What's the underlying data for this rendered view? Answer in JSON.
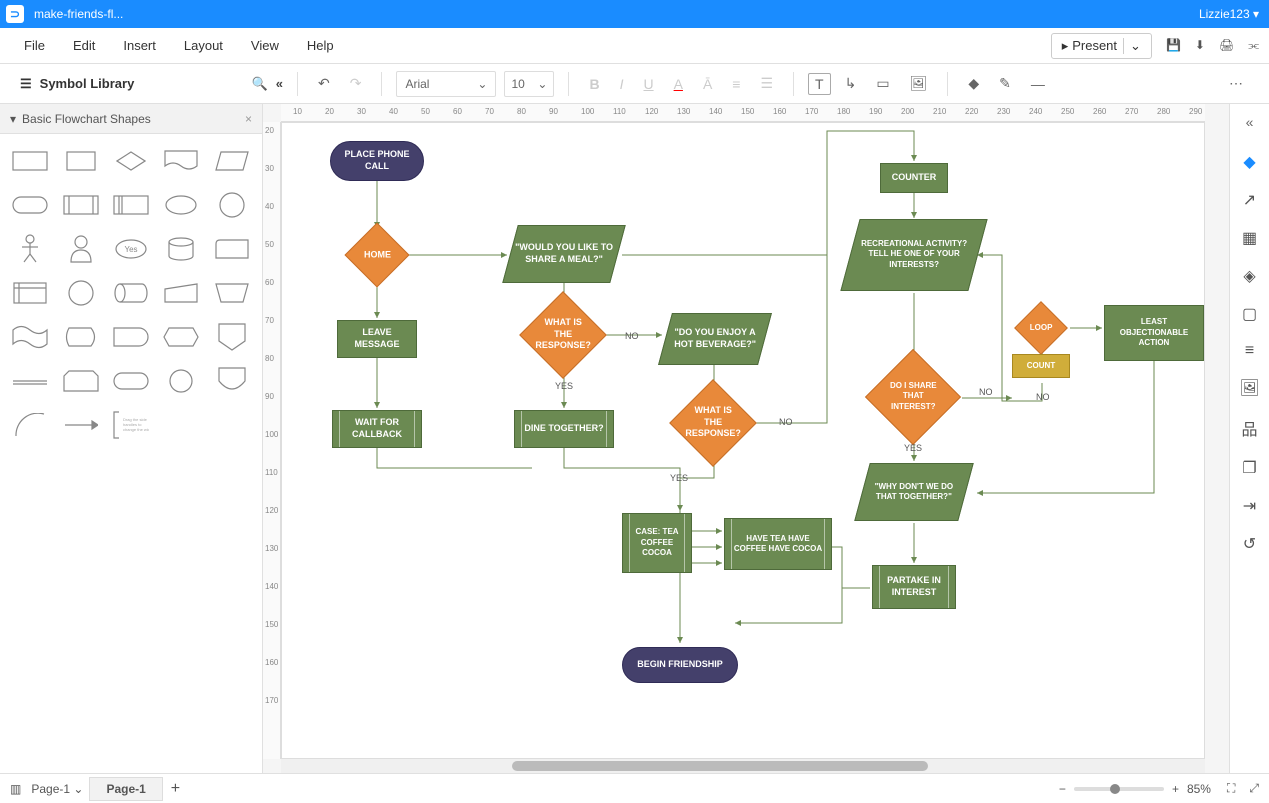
{
  "titlebar": {
    "filename": "make-friends-fl...",
    "user": "Lizzie123"
  },
  "menu": [
    "File",
    "Edit",
    "Insert",
    "Layout",
    "View",
    "Help"
  ],
  "present_label": "Present",
  "toolbar": {
    "font": "Arial",
    "size": "10"
  },
  "sidebar": {
    "title": "Symbol Library",
    "category": "Basic Flowchart Shapes",
    "yes_label": "Yes"
  },
  "ruler_h": [
    "10",
    "20",
    "30",
    "40",
    "50",
    "60",
    "70",
    "80",
    "90",
    "100",
    "110",
    "120",
    "130",
    "140",
    "150",
    "160",
    "170",
    "180",
    "190",
    "200",
    "210",
    "220",
    "230",
    "240",
    "250",
    "260",
    "270",
    "280",
    "290"
  ],
  "ruler_v": [
    "20",
    "30",
    "40",
    "50",
    "60",
    "70",
    "80",
    "90",
    "100",
    "110",
    "120",
    "130",
    "140",
    "150",
    "160",
    "170"
  ],
  "pages": {
    "dropdown": "Page-1",
    "tab": "Page-1"
  },
  "zoom": {
    "value": "85%"
  },
  "nodes": {
    "start": "PLACE PHONE CALL",
    "home": "HOME",
    "leave_msg": "LEAVE MESSAGE",
    "wait_cb": "WAIT FOR CALLBACK",
    "share_meal": "\"WOULD YOU LIKE TO SHARE A MEAL?\"",
    "resp1": "WHAT IS THE RESPONSE?",
    "dine": "DINE TOGETHER?",
    "hot_bev": "\"DO YOU ENJOY A HOT BEVERAGE?\"",
    "resp2": "WHAT IS THE RESPONSE?",
    "case": "CASE: TEA COFFEE COCOA",
    "have": "HAVE TEA HAVE COFFEE HAVE COCOA",
    "begin": "BEGIN FRIENDSHIP",
    "counter": "COUNTER",
    "recreate": "RECREATIONAL ACTIVITY? TELL HE ONE OF YOUR INTERESTS?",
    "share_int": "DO I SHARE THAT INTEREST?",
    "why_not": "\"WHY DON'T WE DO THAT TOGETHER?\"",
    "partake": "PARTAKE IN INTEREST",
    "loop": "LOOP",
    "count": "COUNT",
    "least": "LEAST OBJECTIONABLE ACTION"
  },
  "labels": {
    "yes": "YES",
    "no": "NO"
  }
}
